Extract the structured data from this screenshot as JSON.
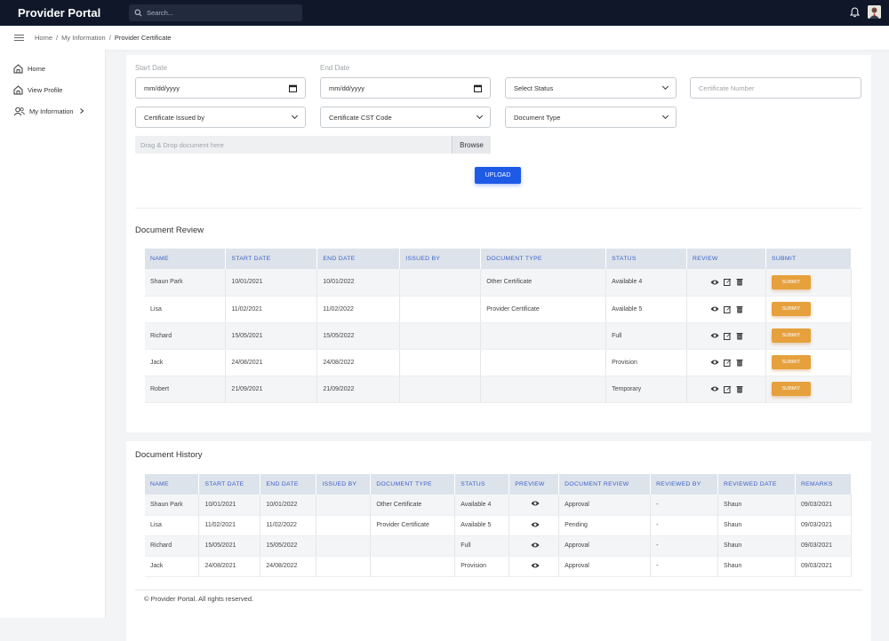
{
  "header": {
    "brand": "Provider Portal",
    "search_placeholder": "Search..."
  },
  "breadcrumb": {
    "items": [
      "Home",
      "My Information"
    ],
    "separator": "/",
    "current": "Provider Certificate"
  },
  "sidebar": {
    "items": [
      {
        "label": "Home",
        "icon": "home-icon"
      },
      {
        "label": "View Profile",
        "icon": "home-icon"
      },
      {
        "label": "My Information",
        "icon": "users-icon"
      }
    ]
  },
  "form": {
    "start_date_label": "Start Date",
    "end_date_label": "End Date",
    "start_date_placeholder": "mm/dd/yyyy",
    "end_date_placeholder": "mm/dd/yyyy",
    "status_select": "Select Status",
    "certificate_number_placeholder": "Certificate Number",
    "issued_by_select": "Certificate Issued by",
    "cst_code_select": "Certificate CST Code",
    "document_type_select": "Document Type",
    "dropzone_text": "Drag & Drop document here",
    "browse_label": "Browse",
    "upload_label": "UPLOAD"
  },
  "document_review": {
    "title": "Document Review",
    "columns": [
      "NAME",
      "START DATE",
      "END DATE",
      "ISSUED BY",
      "DOCUMENT TYPE",
      "STATUS",
      "REVIEW",
      "SUBMIT"
    ],
    "submit_label": "SUBMIT",
    "rows": [
      {
        "name": "Shaun Park",
        "start": "10/01/2021",
        "end": "10/01/2022",
        "issued_by": "",
        "doc_type": "Other Certificate",
        "status": "Available 4"
      },
      {
        "name": "Lisa",
        "start": "11/02/2021",
        "end": "11/02/2022",
        "issued_by": "",
        "doc_type": "Provider Certificate",
        "status": "Available 5"
      },
      {
        "name": "Richard",
        "start": "15/05/2021",
        "end": "15/05/2022",
        "issued_by": "",
        "doc_type": "",
        "status": "Full"
      },
      {
        "name": "Jack",
        "start": "24/08/2021",
        "end": "24/08/2022",
        "issued_by": "",
        "doc_type": "",
        "status": "Provision"
      },
      {
        "name": "Robert",
        "start": "21/09/2021",
        "end": "21/09/2022",
        "issued_by": "",
        "doc_type": "",
        "status": "Temporary"
      }
    ]
  },
  "document_history": {
    "title": "Document History",
    "columns": [
      "NAME",
      "START DATE",
      "END DATE",
      "ISSUED BY",
      "DOCUMENT TYPE",
      "STATUS",
      "PREVIEW",
      "DOCUMENT REVIEW",
      "REVIEWED BY",
      "REVIEWED DATE",
      "REMARKS"
    ],
    "rows": [
      {
        "name": "Shaun Park",
        "start": "10/01/2021",
        "end": "10/01/2022",
        "issued_by": "",
        "doc_type": "Other Certificate",
        "status": "Available 4",
        "review": "Approval",
        "reviewed_by": "-",
        "reviewed_date": "Shaun",
        "remarks": "09/03/2021"
      },
      {
        "name": "Lisa",
        "start": "11/02/2021",
        "end": "11/02/2022",
        "issued_by": "",
        "doc_type": "Provider Certificate",
        "status": "Available 5",
        "review": "Pending",
        "reviewed_by": "-",
        "reviewed_date": "Shaun",
        "remarks": "09/03/2021"
      },
      {
        "name": "Richard",
        "start": "15/05/2021",
        "end": "15/05/2022",
        "issued_by": "",
        "doc_type": "",
        "status": "Full",
        "review": "Approval",
        "reviewed_by": "-",
        "reviewed_date": "Shaun",
        "remarks": "09/03/2021"
      },
      {
        "name": "Jack",
        "start": "24/08/2021",
        "end": "24/08/2022",
        "issued_by": "",
        "doc_type": "",
        "status": "Provision",
        "review": "Approval",
        "reviewed_by": "-",
        "reviewed_date": "Shaun",
        "remarks": "09/03/2021"
      }
    ]
  },
  "footer": {
    "text": "© Provider Portal. All rights reserved."
  }
}
